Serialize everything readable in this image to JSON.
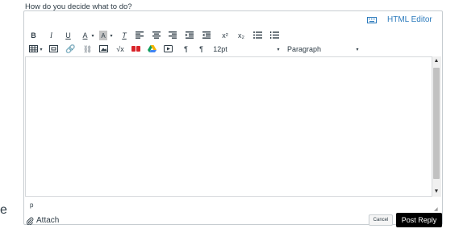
{
  "prompt": "How do you decide what to do?",
  "html_editor_label": "HTML Editor",
  "toolbar": {
    "bold": "B",
    "italic": "I",
    "underline": "U",
    "text_color": "A",
    "background_color": "A",
    "clear_format": "T",
    "superscript": "x²",
    "subscript": "x₂",
    "ltr": "¶",
    "rtl": "¶",
    "font_size": "12pt",
    "block_format": "Paragraph"
  },
  "status_path": "p",
  "partial_left_char": "e",
  "attach_label": "Attach",
  "cancel_label": "Cancel",
  "post_reply_label": "Post Reply",
  "colors": {
    "link": "#2b7abc",
    "primary_button": "#000000",
    "media_icon_red": "#d9242a",
    "drive_blue": "#4285f4",
    "drive_green": "#0f9d58",
    "drive_yellow": "#f4b400"
  }
}
